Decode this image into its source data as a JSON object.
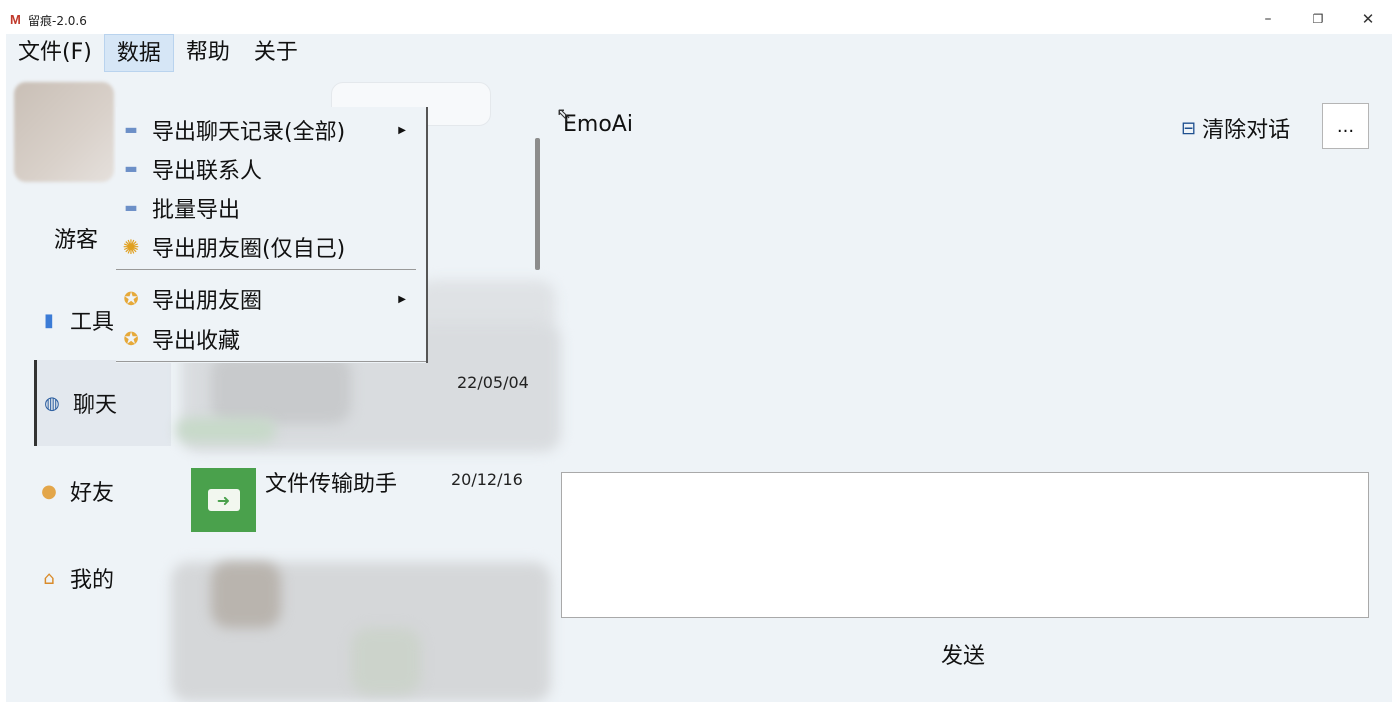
{
  "window": {
    "app_icon": "M",
    "title": "留痕-2.0.6",
    "min_glyph": "–",
    "max_glyph": "❐",
    "close_glyph": "✕"
  },
  "menubar": [
    "文件(F)",
    "数据",
    "帮助",
    "关于"
  ],
  "dropdown": {
    "items": [
      {
        "label": "导出聊天记录(全部)",
        "icon": "folder-icon",
        "submenu": true
      },
      {
        "label": "导出联系人",
        "icon": "folder-icon",
        "submenu": false
      },
      {
        "label": "批量导出",
        "icon": "folder-icon",
        "submenu": false
      },
      {
        "label": "导出朋友圈(仅自己)",
        "icon": "aperture-icon",
        "submenu": false
      },
      {
        "label": "导出朋友圈",
        "icon": "badge-icon",
        "submenu": true
      },
      {
        "label": "导出收藏",
        "icon": "badge-icon",
        "submenu": false
      }
    ]
  },
  "sidebar": {
    "user": "游客",
    "items": [
      {
        "label": "工具",
        "icon": "tools-icon"
      },
      {
        "label": "聊天",
        "icon": "chat-icon"
      },
      {
        "label": "好友",
        "icon": "friends-icon"
      },
      {
        "label": "我的",
        "icon": "home-icon"
      }
    ]
  },
  "chats": {
    "date1": "22/05/04",
    "name2": "文件传输助手",
    "date2": "20/12/16"
  },
  "conversation": {
    "title": "EmoAi",
    "clear": "清除对话",
    "more": "...",
    "send": "发送"
  },
  "colors": {
    "background": "#eef3f7",
    "accent": "#4aa14c",
    "menu_active": "#d6e6f6"
  }
}
